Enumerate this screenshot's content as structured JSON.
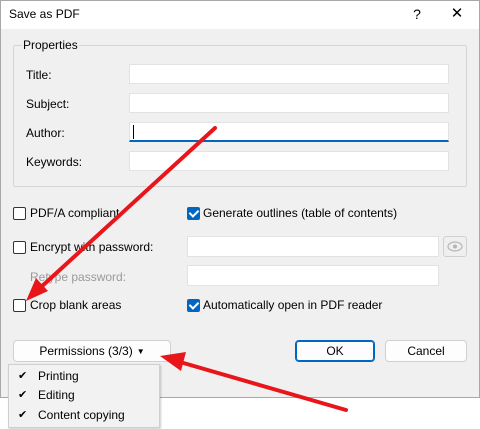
{
  "dialog": {
    "title": "Save as PDF",
    "help_glyph": "?",
    "close_glyph": "✕"
  },
  "properties": {
    "legend": "Properties",
    "fields": [
      {
        "label": "Title:",
        "value": ""
      },
      {
        "label": "Subject:",
        "value": ""
      },
      {
        "label": "Author:",
        "value": ""
      },
      {
        "label": "Keywords:",
        "value": ""
      }
    ]
  },
  "options": {
    "pdfa": {
      "label": "PDF/A compliant",
      "checked": false
    },
    "outlines": {
      "label": "Generate outlines (table of contents)",
      "checked": true
    },
    "encrypt": {
      "label": "Encrypt with password:",
      "checked": false
    },
    "retype_label": "Retype password:",
    "crop": {
      "label": "Crop blank areas",
      "checked": false
    },
    "auto_open": {
      "label": "Automatically open in PDF reader",
      "checked": true
    }
  },
  "buttons": {
    "permissions": "Permissions (3/3)",
    "ok": "OK",
    "cancel": "Cancel"
  },
  "permissions_menu": [
    {
      "label": "Printing",
      "checked": true
    },
    {
      "label": "Editing",
      "checked": true
    },
    {
      "label": "Content copying",
      "checked": true
    }
  ],
  "colors": {
    "accent": "#0067c0",
    "annotation_arrow": "#e8161b"
  },
  "icons": {
    "password_toggle": "eye-icon",
    "dropdown": "chevron-down-icon",
    "check": "checkmark-icon"
  }
}
